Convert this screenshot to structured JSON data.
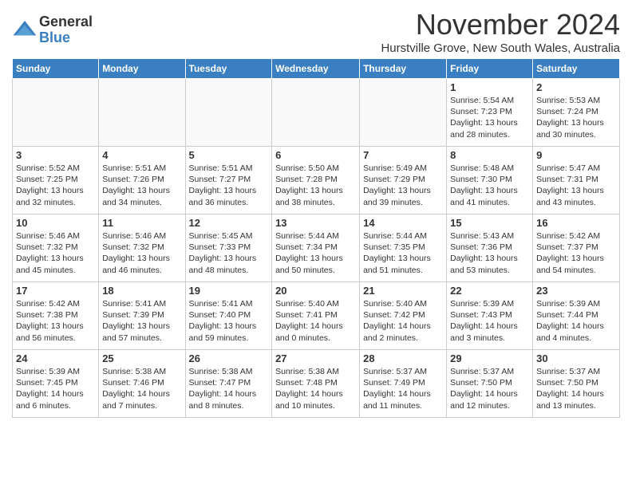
{
  "logo": {
    "general": "General",
    "blue": "Blue"
  },
  "title": "November 2024",
  "location": "Hurstville Grove, New South Wales, Australia",
  "days_of_week": [
    "Sunday",
    "Monday",
    "Tuesday",
    "Wednesday",
    "Thursday",
    "Friday",
    "Saturday"
  ],
  "weeks": [
    [
      {
        "day": "",
        "info": ""
      },
      {
        "day": "",
        "info": ""
      },
      {
        "day": "",
        "info": ""
      },
      {
        "day": "",
        "info": ""
      },
      {
        "day": "",
        "info": ""
      },
      {
        "day": "1",
        "info": "Sunrise: 5:54 AM\nSunset: 7:23 PM\nDaylight: 13 hours and 28 minutes."
      },
      {
        "day": "2",
        "info": "Sunrise: 5:53 AM\nSunset: 7:24 PM\nDaylight: 13 hours and 30 minutes."
      }
    ],
    [
      {
        "day": "3",
        "info": "Sunrise: 5:52 AM\nSunset: 7:25 PM\nDaylight: 13 hours and 32 minutes."
      },
      {
        "day": "4",
        "info": "Sunrise: 5:51 AM\nSunset: 7:26 PM\nDaylight: 13 hours and 34 minutes."
      },
      {
        "day": "5",
        "info": "Sunrise: 5:51 AM\nSunset: 7:27 PM\nDaylight: 13 hours and 36 minutes."
      },
      {
        "day": "6",
        "info": "Sunrise: 5:50 AM\nSunset: 7:28 PM\nDaylight: 13 hours and 38 minutes."
      },
      {
        "day": "7",
        "info": "Sunrise: 5:49 AM\nSunset: 7:29 PM\nDaylight: 13 hours and 39 minutes."
      },
      {
        "day": "8",
        "info": "Sunrise: 5:48 AM\nSunset: 7:30 PM\nDaylight: 13 hours and 41 minutes."
      },
      {
        "day": "9",
        "info": "Sunrise: 5:47 AM\nSunset: 7:31 PM\nDaylight: 13 hours and 43 minutes."
      }
    ],
    [
      {
        "day": "10",
        "info": "Sunrise: 5:46 AM\nSunset: 7:32 PM\nDaylight: 13 hours and 45 minutes."
      },
      {
        "day": "11",
        "info": "Sunrise: 5:46 AM\nSunset: 7:32 PM\nDaylight: 13 hours and 46 minutes."
      },
      {
        "day": "12",
        "info": "Sunrise: 5:45 AM\nSunset: 7:33 PM\nDaylight: 13 hours and 48 minutes."
      },
      {
        "day": "13",
        "info": "Sunrise: 5:44 AM\nSunset: 7:34 PM\nDaylight: 13 hours and 50 minutes."
      },
      {
        "day": "14",
        "info": "Sunrise: 5:44 AM\nSunset: 7:35 PM\nDaylight: 13 hours and 51 minutes."
      },
      {
        "day": "15",
        "info": "Sunrise: 5:43 AM\nSunset: 7:36 PM\nDaylight: 13 hours and 53 minutes."
      },
      {
        "day": "16",
        "info": "Sunrise: 5:42 AM\nSunset: 7:37 PM\nDaylight: 13 hours and 54 minutes."
      }
    ],
    [
      {
        "day": "17",
        "info": "Sunrise: 5:42 AM\nSunset: 7:38 PM\nDaylight: 13 hours and 56 minutes."
      },
      {
        "day": "18",
        "info": "Sunrise: 5:41 AM\nSunset: 7:39 PM\nDaylight: 13 hours and 57 minutes."
      },
      {
        "day": "19",
        "info": "Sunrise: 5:41 AM\nSunset: 7:40 PM\nDaylight: 13 hours and 59 minutes."
      },
      {
        "day": "20",
        "info": "Sunrise: 5:40 AM\nSunset: 7:41 PM\nDaylight: 14 hours and 0 minutes."
      },
      {
        "day": "21",
        "info": "Sunrise: 5:40 AM\nSunset: 7:42 PM\nDaylight: 14 hours and 2 minutes."
      },
      {
        "day": "22",
        "info": "Sunrise: 5:39 AM\nSunset: 7:43 PM\nDaylight: 14 hours and 3 minutes."
      },
      {
        "day": "23",
        "info": "Sunrise: 5:39 AM\nSunset: 7:44 PM\nDaylight: 14 hours and 4 minutes."
      }
    ],
    [
      {
        "day": "24",
        "info": "Sunrise: 5:39 AM\nSunset: 7:45 PM\nDaylight: 14 hours and 6 minutes."
      },
      {
        "day": "25",
        "info": "Sunrise: 5:38 AM\nSunset: 7:46 PM\nDaylight: 14 hours and 7 minutes."
      },
      {
        "day": "26",
        "info": "Sunrise: 5:38 AM\nSunset: 7:47 PM\nDaylight: 14 hours and 8 minutes."
      },
      {
        "day": "27",
        "info": "Sunrise: 5:38 AM\nSunset: 7:48 PM\nDaylight: 14 hours and 10 minutes."
      },
      {
        "day": "28",
        "info": "Sunrise: 5:37 AM\nSunset: 7:49 PM\nDaylight: 14 hours and 11 minutes."
      },
      {
        "day": "29",
        "info": "Sunrise: 5:37 AM\nSunset: 7:50 PM\nDaylight: 14 hours and 12 minutes."
      },
      {
        "day": "30",
        "info": "Sunrise: 5:37 AM\nSunset: 7:50 PM\nDaylight: 14 hours and 13 minutes."
      }
    ]
  ]
}
